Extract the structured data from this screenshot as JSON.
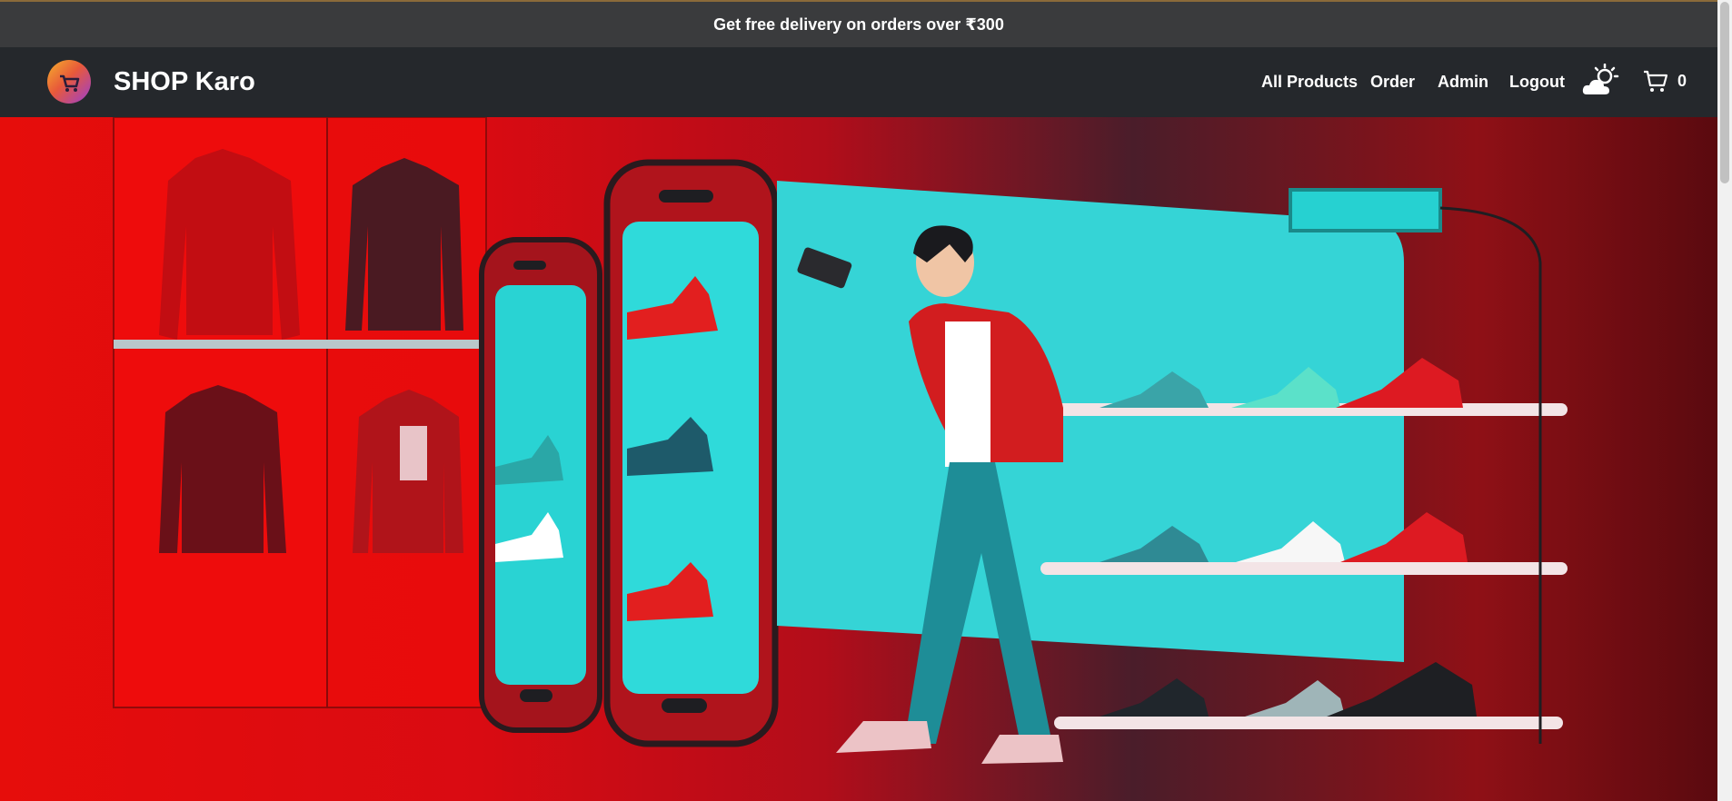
{
  "promo": {
    "text": "Get free delivery on orders over ₹300"
  },
  "brand": {
    "name": "SHOP Karo",
    "logo_icon": "cart-logo-icon"
  },
  "nav": {
    "links": [
      "All Products",
      "Order",
      "Admin",
      "Logout"
    ],
    "weather_icon": "weather-sun-cloud-icon",
    "cart_icon": "shopping-cart-icon",
    "cart_count": "0"
  },
  "hero": {
    "image": "shopping-illustration",
    "colors": {
      "red": "#e60d0b",
      "cyan": "#2bd6d6"
    }
  }
}
